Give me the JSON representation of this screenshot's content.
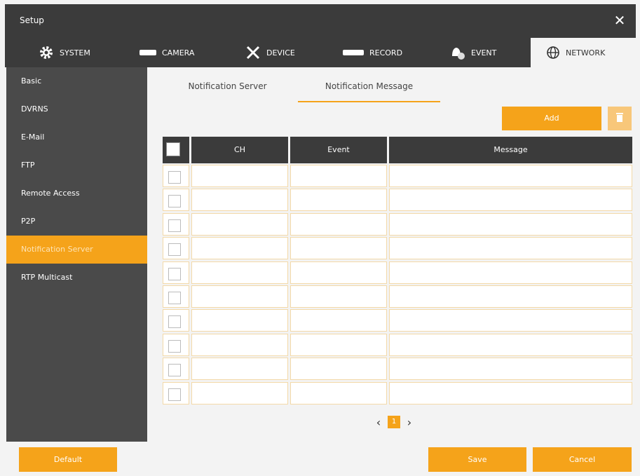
{
  "window": {
    "title": "Setup",
    "close_glyph": "✕"
  },
  "tabs": [
    {
      "label": "SYSTEM",
      "icon": "gear-icon"
    },
    {
      "label": "CAMERA",
      "icon": "camera-icon"
    },
    {
      "label": "DEVICE",
      "icon": "tools-icon"
    },
    {
      "label": "RECORD",
      "icon": "record-icon"
    },
    {
      "label": "EVENT",
      "icon": "bell-icon"
    },
    {
      "label": "NETWORK",
      "icon": "globe-icon",
      "active": true
    }
  ],
  "sidebar": {
    "items": [
      {
        "label": "Basic"
      },
      {
        "label": "DVRNS"
      },
      {
        "label": "E-Mail"
      },
      {
        "label": "FTP"
      },
      {
        "label": "Remote Access"
      },
      {
        "label": "P2P"
      },
      {
        "label": "Notification Server",
        "active": true
      },
      {
        "label": "RTP Multicast"
      }
    ]
  },
  "subtabs": [
    {
      "label": "Notification Server"
    },
    {
      "label": "Notification Message",
      "active": true
    }
  ],
  "actions": {
    "add_label": "Add",
    "delete_icon": "trash-icon"
  },
  "table": {
    "columns": [
      "CH",
      "Event",
      "Message"
    ],
    "row_count": 10
  },
  "pagination": {
    "prev": "‹",
    "current": "1",
    "next": "›"
  },
  "footer": {
    "default_label": "Default",
    "save_label": "Save",
    "cancel_label": "Cancel"
  },
  "colors": {
    "accent": "#f5a31a",
    "dark": "#3b3b3b",
    "sidebar": "#4a4a4a"
  }
}
